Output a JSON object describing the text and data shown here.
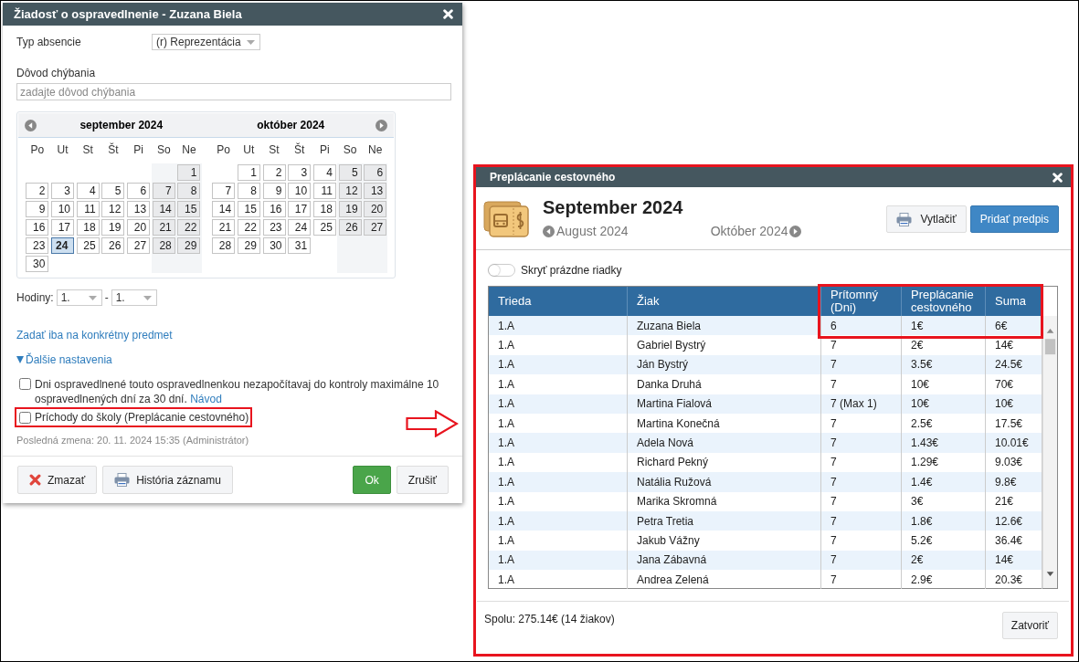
{
  "excuse_dialog": {
    "title": "Žiadosť o ospravedlnenie - Zuzana Biela",
    "absence_type": {
      "label": "Typ absencie",
      "value": "(r) Reprezentácia"
    },
    "reason": {
      "label": "Dôvod chýbania",
      "placeholder": "zadajte dôvod chýbania"
    },
    "calendar": {
      "months": [
        {
          "title": "september 2024",
          "weekdays": [
            "Po",
            "Ut",
            "St",
            "Št",
            "Pi",
            "So",
            "Ne"
          ],
          "weeks": [
            [
              {
                "kind": "empty"
              },
              {
                "kind": "empty"
              },
              {
                "kind": "empty"
              },
              {
                "kind": "empty"
              },
              {
                "kind": "empty"
              },
              {
                "kind": "empty"
              },
              {
                "kind": "day",
                "day": "1",
                "selected": false
              }
            ],
            [
              {
                "kind": "day",
                "day": "2",
                "selected": false
              },
              {
                "kind": "day",
                "day": "3",
                "selected": false
              },
              {
                "kind": "day",
                "day": "4",
                "selected": false
              },
              {
                "kind": "day",
                "day": "5",
                "selected": false
              },
              {
                "kind": "day",
                "day": "6",
                "selected": false
              },
              {
                "kind": "day",
                "day": "7",
                "selected": false
              },
              {
                "kind": "day",
                "day": "8",
                "selected": false
              }
            ],
            [
              {
                "kind": "day",
                "day": "9",
                "selected": false
              },
              {
                "kind": "day",
                "day": "10",
                "selected": false
              },
              {
                "kind": "day",
                "day": "11",
                "selected": false
              },
              {
                "kind": "day",
                "day": "12",
                "selected": false
              },
              {
                "kind": "day",
                "day": "13",
                "selected": false
              },
              {
                "kind": "day",
                "day": "14",
                "selected": false
              },
              {
                "kind": "day",
                "day": "15",
                "selected": false
              }
            ],
            [
              {
                "kind": "day",
                "day": "16",
                "selected": false
              },
              {
                "kind": "day",
                "day": "17",
                "selected": false
              },
              {
                "kind": "day",
                "day": "18",
                "selected": false
              },
              {
                "kind": "day",
                "day": "19",
                "selected": false
              },
              {
                "kind": "day",
                "day": "20",
                "selected": false
              },
              {
                "kind": "day",
                "day": "21",
                "selected": false
              },
              {
                "kind": "day",
                "day": "22",
                "selected": false
              }
            ],
            [
              {
                "kind": "day",
                "day": "23",
                "selected": false
              },
              {
                "kind": "day",
                "day": "24",
                "selected": true
              },
              {
                "kind": "day",
                "day": "25",
                "selected": false
              },
              {
                "kind": "day",
                "day": "26",
                "selected": false
              },
              {
                "kind": "day",
                "day": "27",
                "selected": false
              },
              {
                "kind": "day",
                "day": "28",
                "selected": false
              },
              {
                "kind": "day",
                "day": "29",
                "selected": false
              }
            ],
            [
              {
                "kind": "day",
                "day": "30",
                "selected": false
              }
            ]
          ]
        },
        {
          "title": "október 2024",
          "weekdays": [
            "Po",
            "Ut",
            "St",
            "Št",
            "Pi",
            "So",
            "Ne"
          ],
          "weeks": [
            [
              {
                "kind": "empty"
              },
              {
                "kind": "day",
                "day": "1",
                "selected": false
              },
              {
                "kind": "day",
                "day": "2",
                "selected": false
              },
              {
                "kind": "day",
                "day": "3",
                "selected": false
              },
              {
                "kind": "day",
                "day": "4",
                "selected": false
              },
              {
                "kind": "day",
                "day": "5",
                "selected": false
              },
              {
                "kind": "day",
                "day": "6",
                "selected": false
              }
            ],
            [
              {
                "kind": "day",
                "day": "7",
                "selected": false
              },
              {
                "kind": "day",
                "day": "8",
                "selected": false
              },
              {
                "kind": "day",
                "day": "9",
                "selected": false
              },
              {
                "kind": "day",
                "day": "10",
                "selected": false
              },
              {
                "kind": "day",
                "day": "11",
                "selected": false
              },
              {
                "kind": "day",
                "day": "12",
                "selected": false
              },
              {
                "kind": "day",
                "day": "13",
                "selected": false
              }
            ],
            [
              {
                "kind": "day",
                "day": "14",
                "selected": false
              },
              {
                "kind": "day",
                "day": "15",
                "selected": false
              },
              {
                "kind": "day",
                "day": "16",
                "selected": false
              },
              {
                "kind": "day",
                "day": "17",
                "selected": false
              },
              {
                "kind": "day",
                "day": "18",
                "selected": false
              },
              {
                "kind": "day",
                "day": "19",
                "selected": false
              },
              {
                "kind": "day",
                "day": "20",
                "selected": false
              }
            ],
            [
              {
                "kind": "day",
                "day": "21",
                "selected": false
              },
              {
                "kind": "day",
                "day": "22",
                "selected": false
              },
              {
                "kind": "day",
                "day": "23",
                "selected": false
              },
              {
                "kind": "day",
                "day": "24",
                "selected": false
              },
              {
                "kind": "day",
                "day": "25",
                "selected": false
              },
              {
                "kind": "day",
                "day": "26",
                "selected": false
              },
              {
                "kind": "day",
                "day": "27",
                "selected": false
              }
            ],
            [
              {
                "kind": "day",
                "day": "28",
                "selected": false
              },
              {
                "kind": "day",
                "day": "29",
                "selected": false
              },
              {
                "kind": "day",
                "day": "30",
                "selected": false
              },
              {
                "kind": "day",
                "day": "31",
                "selected": false
              }
            ]
          ]
        }
      ]
    },
    "hours": {
      "label": "Hodiny:",
      "from": "1.",
      "separator": "-",
      "to": "1."
    },
    "subject_link": "Zadať iba na konkrétny predmet",
    "more_settings": {
      "label": "Ďalšie nastavenia",
      "expanded": true
    },
    "options": [
      {
        "text": "Dni ospravedlnené touto ospravedlnenkou nezapočítavaj do kontroly maximálne 10 ospravedlnených dní za 30 dní.",
        "link": "Návod",
        "checked": false
      },
      {
        "text": "Príchody do školy (Preplácanie cestovného)",
        "checked": false
      }
    ],
    "last_change": "Posledná zmena: 20. 11. 2024 15:35 (Administrátor)",
    "buttons": [
      {
        "kind": "delete",
        "label": "Zmazať"
      },
      {
        "kind": "history",
        "label": "História záznamu"
      },
      {
        "kind": "ok",
        "label": "Ok"
      },
      {
        "kind": "cancel",
        "label": "Zrušiť"
      }
    ]
  },
  "travel_dialog": {
    "title": "Preplácanie cestovného",
    "heading": "September 2024",
    "prev": "August 2024",
    "next": "Október 2024",
    "buttons": [
      {
        "kind": "print",
        "label": "Vytlačiť"
      },
      {
        "kind": "primary",
        "label": "Pridať predpis"
      }
    ],
    "hide_empty": {
      "label": "Skryť prázdne riadky",
      "on": false
    },
    "table": {
      "columns": [
        "Trieda",
        "Žiak",
        "Prítomný (Dni)",
        "Preplácanie cestovného",
        "Suma"
      ],
      "rows": [
        [
          "1.A",
          "Zuzana Biela",
          "6",
          "1€",
          "6€"
        ],
        [
          "1.A",
          "Gabriel Bystrý",
          "7",
          "2€",
          "14€"
        ],
        [
          "1.A",
          "Ján Bystrý",
          "7",
          "3.5€",
          "24.5€"
        ],
        [
          "1.A",
          "Danka Druhá",
          "7",
          "10€",
          "70€"
        ],
        [
          "1.A",
          "Martina Fialová",
          "7 (Max 1)",
          "10€",
          "10€"
        ],
        [
          "1.A",
          "Martina Konečná",
          "7",
          "2.5€",
          "17.5€"
        ],
        [
          "1.A",
          "Adela Nová",
          "7",
          "1.43€",
          "10.01€"
        ],
        [
          "1.A",
          "Richard Pekný",
          "7",
          "1.29€",
          "9.03€"
        ],
        [
          "1.A",
          "Natália Ružová",
          "7",
          "1.4€",
          "9.8€"
        ],
        [
          "1.A",
          "Marika Skromná",
          "7",
          "3€",
          "21€"
        ],
        [
          "1.A",
          "Petra Tretia",
          "7",
          "1.8€",
          "12.6€"
        ],
        [
          "1.A",
          "Jakub Vážny",
          "7",
          "5.2€",
          "36.4€"
        ],
        [
          "1.A",
          "Jana Zábavná",
          "7",
          "2€",
          "14€"
        ],
        [
          "1.A",
          "Andrea Zelená",
          "7",
          "2.9€",
          "20.3€"
        ]
      ]
    },
    "total": "Spolu: 275.14€ (14 žiakov)",
    "close_button": "Zatvoriť"
  }
}
